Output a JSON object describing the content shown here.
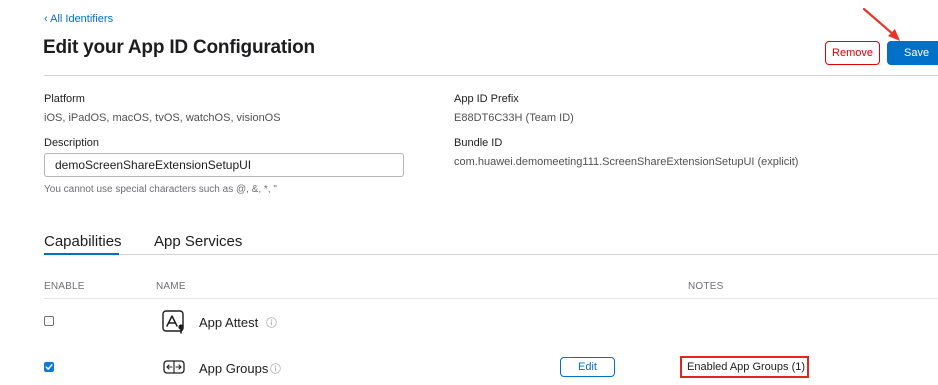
{
  "nav": {
    "back_label": "‹ All Identifiers"
  },
  "header": {
    "title": "Edit your App ID Configuration",
    "remove_label": "Remove",
    "save_label": "Save"
  },
  "details": {
    "platform_label": "Platform",
    "platform_value": "iOS, iPadOS, macOS, tvOS, watchOS, visionOS",
    "prefix_label": "App ID Prefix",
    "prefix_value": "E88DT6C33H (Team ID)",
    "description_label": "Description",
    "description_value": "demoScreenShareExtensionSetupUI",
    "description_hint": "You cannot use special characters such as @, &, *, \"",
    "bundle_label": "Bundle ID",
    "bundle_value": "com.huawei.demomeeting111.ScreenShareExtensionSetupUI (explicit)"
  },
  "tabs": [
    {
      "label": "Capabilities",
      "active": true
    },
    {
      "label": "App Services",
      "active": false
    }
  ],
  "columns": {
    "enable": "ENABLE",
    "name": "NAME",
    "notes": "NOTES"
  },
  "capabilities": [
    {
      "name": "App Attest",
      "enabled": false,
      "icon": "app-attest-icon"
    },
    {
      "name": "App Groups",
      "enabled": true,
      "icon": "app-groups-icon",
      "edit_label": "Edit",
      "note": "Enabled App Groups (1)"
    }
  ],
  "colors": {
    "accent": "#0070c9",
    "danger": "#e30000",
    "annotation": "#e0261e"
  }
}
